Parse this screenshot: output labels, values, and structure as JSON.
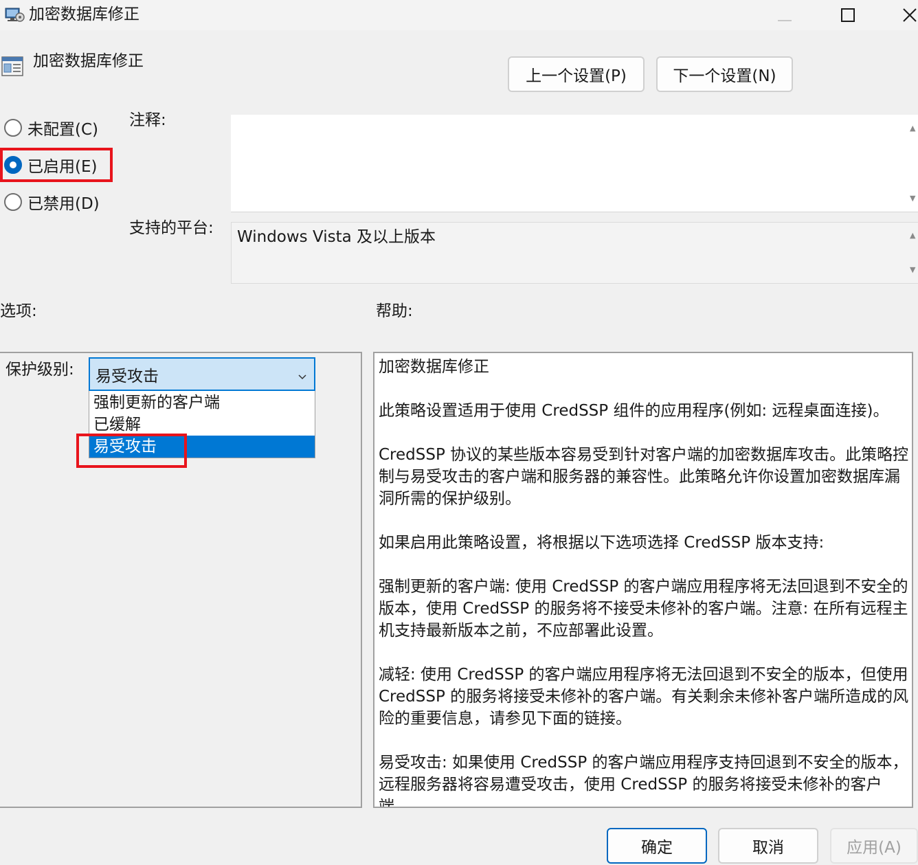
{
  "window": {
    "title": "加密数据库修正",
    "controls": {
      "minimize": "minimize-icon",
      "maximize": "maximize-icon",
      "close": "close-icon"
    }
  },
  "header": {
    "policy_name": "加密数据库修正",
    "prev_button": "上一个设置(P)",
    "next_button": "下一个设置(N)"
  },
  "state": {
    "options": [
      {
        "label": "未配置(C)",
        "checked": false
      },
      {
        "label": "已启用(E)",
        "checked": true
      },
      {
        "label": "已禁用(D)",
        "checked": false
      }
    ]
  },
  "comment": {
    "label": "注释:",
    "value": ""
  },
  "platform": {
    "label": "支持的平台:",
    "value": "Windows Vista 及以上版本"
  },
  "options_pane": {
    "label": "选项:",
    "protection_label": "保护级别:",
    "selected": "易受攻击",
    "dropdown_items": [
      "强制更新的客户端",
      "已缓解",
      "易受攻击"
    ]
  },
  "help": {
    "label": "帮助:",
    "paragraphs": [
      "加密数据库修正",
      "此策略设置适用于使用 CredSSP 组件的应用程序(例如: 远程桌面连接)。",
      "CredSSP 协议的某些版本容易受到针对客户端的加密数据库攻击。此策略控制与易受攻击的客户端和服务器的兼容性。此策略允许你设置加密数据库漏洞所需的保护级别。",
      "如果启用此策略设置，将根据以下选项选择 CredSSP 版本支持:",
      "强制更新的客户端: 使用 CredSSP 的客户端应用程序将无法回退到不安全的版本，使用 CredSSP 的服务将不接受未修补的客户端。注意: 在所有远程主机支持最新版本之前，不应部署此设置。",
      "减轻: 使用 CredSSP 的客户端应用程序将无法回退到不安全的版本，但使用 CredSSP 的服务将接受未修补的客户端。有关剩余未修补客户端所造成的风险的重要信息，请参见下面的链接。",
      "易受攻击: 如果使用 CredSSP 的客户端应用程序支持回退到不安全的版本，远程服务器将容易遭受攻击，使用 CredSSP 的服务将接受未修补的客户端。"
    ]
  },
  "buttons": {
    "ok": "确定",
    "cancel": "取消",
    "apply": "应用(A)"
  },
  "colors": {
    "accent": "#0078d4",
    "highlight": "#e8141c"
  }
}
